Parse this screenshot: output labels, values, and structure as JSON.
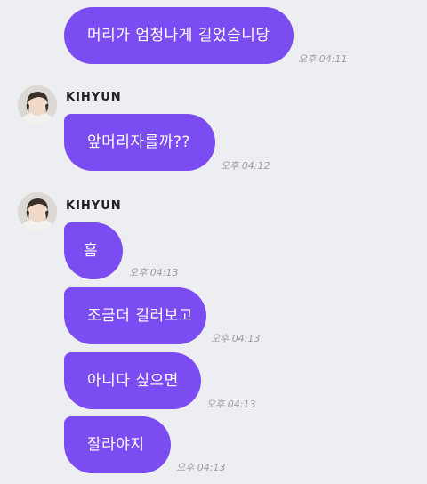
{
  "messages": [
    {
      "text": "머리가 엄청나게 길었습니당",
      "time": "오후 04:11"
    },
    {
      "sender": "KIHYUN",
      "text": "앞머리자를까??",
      "time": "오후 04:12"
    },
    {
      "sender": "KIHYUN",
      "text": "흠",
      "time": "오후 04:13"
    },
    {
      "text": "조금더 길러보고",
      "time": "오후 04:13"
    },
    {
      "text": "아니다 싶으면",
      "time": "오후 04:13"
    },
    {
      "text": "잘라야지",
      "time": "오후 04:13"
    }
  ],
  "colors": {
    "background": "#eceef2",
    "bubble": "#7a4cf2",
    "bubble_text": "#ffffff",
    "time_text": "#9a9ca3"
  },
  "icons": {
    "avatar": "profile-photo-avatar"
  }
}
